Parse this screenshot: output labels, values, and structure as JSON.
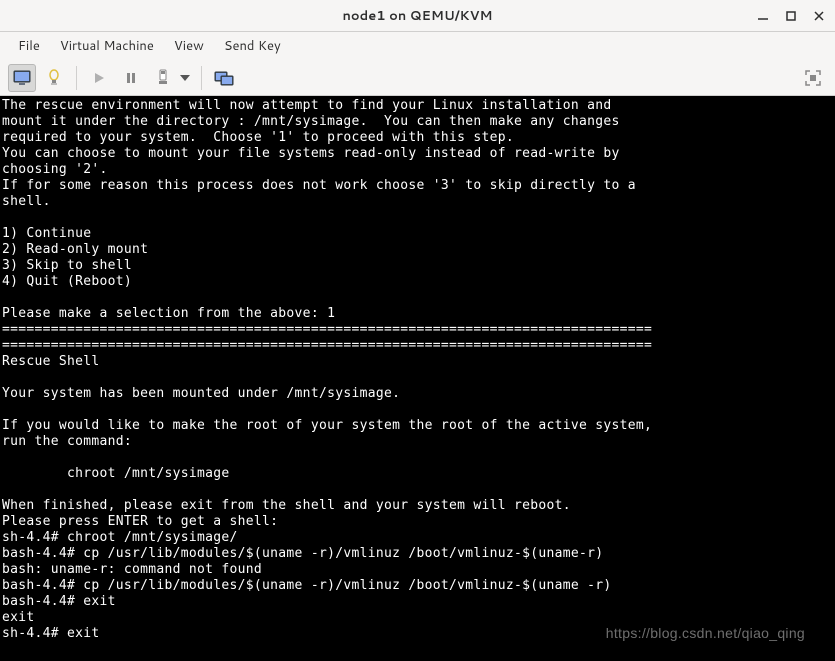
{
  "window": {
    "title": "node1 on QEMU/KVM"
  },
  "menu": {
    "file": "File",
    "virtual_machine": "Virtual Machine",
    "view": "View",
    "send_key": "Send Key"
  },
  "terminal": {
    "content": "The rescue environment will now attempt to find your Linux installation and\nmount it under the directory : /mnt/sysimage.  You can then make any changes\nrequired to your system.  Choose '1' to proceed with this step.\nYou can choose to mount your file systems read-only instead of read-write by\nchoosing '2'.\nIf for some reason this process does not work choose '3' to skip directly to a\nshell.\n\n1) Continue\n2) Read-only mount\n3) Skip to shell\n4) Quit (Reboot)\n\nPlease make a selection from the above: 1\n================================================================================\n================================================================================\nRescue Shell\n\nYour system has been mounted under /mnt/sysimage.\n\nIf you would like to make the root of your system the root of the active system,\nrun the command:\n\n        chroot /mnt/sysimage\n\nWhen finished, please exit from the shell and your system will reboot.\nPlease press ENTER to get a shell:\nsh-4.4# chroot /mnt/sysimage/\nbash-4.4# cp /usr/lib/modules/$(uname -r)/vmlinuz /boot/vmlinuz-$(uname-r)\nbash: uname-r: command not found\nbash-4.4# cp /usr/lib/modules/$(uname -r)/vmlinuz /boot/vmlinuz-$(uname -r)\nbash-4.4# exit\nexit\nsh-4.4# exit"
  },
  "watermark": "https://blog.csdn.net/qiao_qing"
}
